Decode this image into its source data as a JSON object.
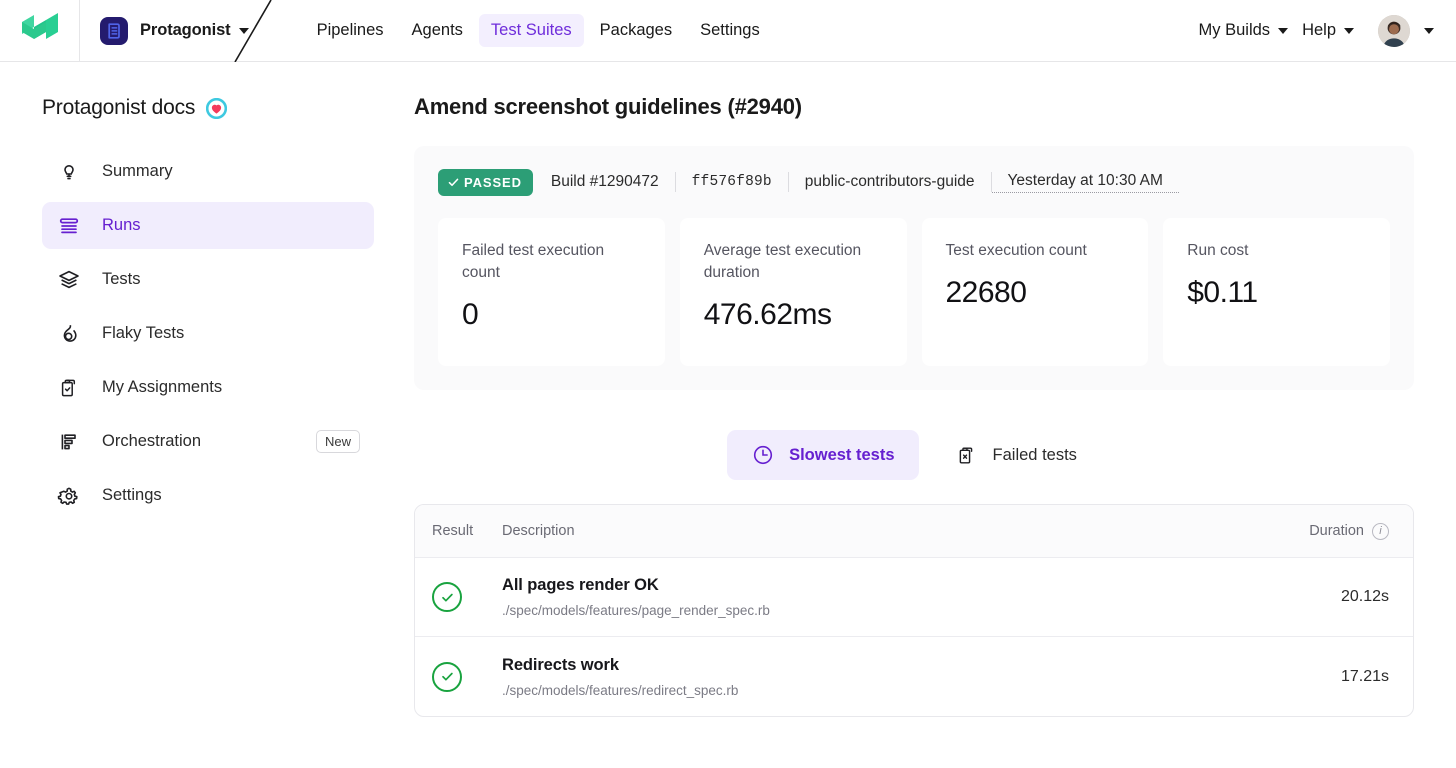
{
  "topnav": {
    "logo_icon": "buildkite-logo-icon",
    "org": {
      "name": "Protagonist",
      "icon": "protagonist-brand-icon"
    },
    "items": [
      {
        "label": "Pipelines",
        "active": false
      },
      {
        "label": "Agents",
        "active": false
      },
      {
        "label": "Test Suites",
        "active": true
      },
      {
        "label": "Packages",
        "active": false
      },
      {
        "label": "Settings",
        "active": false
      }
    ],
    "right": [
      {
        "label": "My Builds"
      },
      {
        "label": "Help"
      }
    ],
    "avatar_alt": "user-avatar"
  },
  "sidebar": {
    "title": "Protagonist docs",
    "title_emoji": "heart-in-circle-emoji",
    "items": [
      {
        "label": "Summary",
        "icon": "lightbulb-icon",
        "active": false,
        "badge": ""
      },
      {
        "label": "Runs",
        "icon": "runs-lines-icon",
        "active": true,
        "badge": ""
      },
      {
        "label": "Tests",
        "icon": "layers-icon",
        "active": false,
        "badge": ""
      },
      {
        "label": "Flaky Tests",
        "icon": "flame-icon",
        "active": false,
        "badge": ""
      },
      {
        "label": "My Assignments",
        "icon": "clipboard-check-icon",
        "active": false,
        "badge": ""
      },
      {
        "label": "Orchestration",
        "icon": "orchestration-bars-icon",
        "active": false,
        "badge": "New"
      },
      {
        "label": "Settings",
        "icon": "gear-icon",
        "active": false,
        "badge": ""
      }
    ]
  },
  "main": {
    "page_title": "Amend screenshot guidelines (#2940)",
    "meta": {
      "status": "PASSED",
      "status_color": "#2c9e76",
      "build": "Build #1290472",
      "commit": "ff576f89b",
      "branch": "public-contributors-guide",
      "time": "Yesterday at 10:30 AM"
    },
    "metrics": [
      {
        "label": "Failed test execution count",
        "value": "0",
        "nowrap": false
      },
      {
        "label": "Average test execution duration",
        "value": "476.62ms",
        "nowrap": false
      },
      {
        "label": "Test execution count",
        "value": "22680",
        "nowrap": true
      },
      {
        "label": "Run cost",
        "value": "$0.11",
        "nowrap": true
      }
    ],
    "tabs": [
      {
        "label": "Slowest tests",
        "icon": "clock-icon",
        "active": true
      },
      {
        "label": "Failed tests",
        "icon": "clipboard-x-icon",
        "active": false
      }
    ],
    "table": {
      "columns": {
        "result": "Result",
        "description": "Description",
        "duration": "Duration"
      },
      "duration_info_icon": "info-icon",
      "rows": [
        {
          "result_icon": "check-circle-icon",
          "title": "All pages render OK",
          "path": "./spec/models/features/page_render_spec.rb",
          "duration": "20.12s"
        },
        {
          "result_icon": "check-circle-icon",
          "title": "Redirects work",
          "path": "./spec/models/features/redirect_spec.rb",
          "duration": "17.21s"
        }
      ]
    }
  },
  "colors": {
    "accent_purple": "#6620d0",
    "accent_purple_bg": "#f1edfd",
    "status_green": "#2c9e76",
    "check_green": "#19a33f",
    "logo_green": "#30d189"
  }
}
